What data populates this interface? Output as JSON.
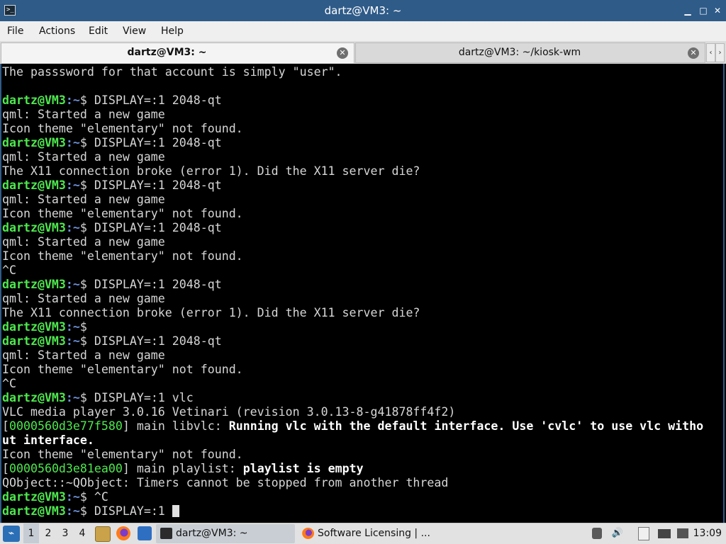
{
  "window": {
    "title": "dartz@VM3: ~",
    "app_icon": ">_",
    "buttons": {
      "minimize": "▁",
      "maximize": "□",
      "close": "✕"
    }
  },
  "menu": {
    "items": [
      "File",
      "Actions",
      "Edit",
      "View",
      "Help"
    ]
  },
  "tabs": [
    {
      "label": "dartz@VM3: ~",
      "active": true
    },
    {
      "label": "dartz@VM3: ~/kiosk-wm",
      "active": false
    }
  ],
  "tab_scroll": {
    "left": "‹",
    "right": "›"
  },
  "terminal": {
    "prompt_user": "dartz@VM3",
    "prompt_path": ":~",
    "prompt_symbol": "$ ",
    "lines": [
      {
        "type": "out",
        "text": "The passsword for that account is simply \"user\"."
      },
      {
        "type": "out",
        "text": ""
      },
      {
        "type": "cmd",
        "text": "DISPLAY=:1 2048-qt"
      },
      {
        "type": "out",
        "text": "qml: Started a new game"
      },
      {
        "type": "out",
        "text": "Icon theme \"elementary\" not found."
      },
      {
        "type": "cmd",
        "text": "DISPLAY=:1 2048-qt"
      },
      {
        "type": "out",
        "text": "qml: Started a new game"
      },
      {
        "type": "out",
        "text": "The X11 connection broke (error 1). Did the X11 server die?"
      },
      {
        "type": "cmd",
        "text": "DISPLAY=:1 2048-qt"
      },
      {
        "type": "out",
        "text": "qml: Started a new game"
      },
      {
        "type": "out",
        "text": "Icon theme \"elementary\" not found."
      },
      {
        "type": "cmd",
        "text": "DISPLAY=:1 2048-qt"
      },
      {
        "type": "out",
        "text": "qml: Started a new game"
      },
      {
        "type": "out",
        "text": "Icon theme \"elementary\" not found."
      },
      {
        "type": "out",
        "text": "^C"
      },
      {
        "type": "cmd",
        "text": "DISPLAY=:1 2048-qt"
      },
      {
        "type": "out",
        "text": "qml: Started a new game"
      },
      {
        "type": "out",
        "text": "The X11 connection broke (error 1). Did the X11 server die?"
      },
      {
        "type": "cmd",
        "text": ""
      },
      {
        "type": "cmd",
        "text": "DISPLAY=:1 2048-qt"
      },
      {
        "type": "out",
        "text": "qml: Started a new game"
      },
      {
        "type": "out",
        "text": "Icon theme \"elementary\" not found."
      },
      {
        "type": "out",
        "text": "^C"
      },
      {
        "type": "cmd",
        "text": "DISPLAY=:1 vlc"
      },
      {
        "type": "out",
        "text": "VLC media player 3.0.16 Vetinari (revision 3.0.13-8-g41878ff4f2)"
      },
      {
        "type": "log",
        "hex": "0000560d3e77f580",
        "module": " main libvlc: ",
        "msg": "Running vlc with the default interface. Use 'cvlc' to use vlc witho"
      },
      {
        "type": "bold",
        "text": "ut interface."
      },
      {
        "type": "out",
        "text": "Icon theme \"elementary\" not found."
      },
      {
        "type": "log",
        "hex": "0000560d3e81ea00",
        "module": " main playlist: ",
        "msg": "playlist is empty"
      },
      {
        "type": "out",
        "text": "QObject::~QObject: Timers cannot be stopped from another thread"
      },
      {
        "type": "cmd",
        "text": "^C"
      },
      {
        "type": "cmd",
        "text": "DISPLAY=:1 ",
        "cursor": true
      }
    ]
  },
  "taskbar": {
    "start_icon": "⌁",
    "workspaces": [
      "1",
      "2",
      "3",
      "4"
    ],
    "active_workspace": "1",
    "tasks": [
      {
        "label": "dartz@VM3: ~",
        "icon": "terminal-icon"
      },
      {
        "label": "Software Licensing | ...",
        "icon": "firefox-icon"
      }
    ],
    "tray": {
      "volume": "🔊",
      "clock": "13:09"
    }
  },
  "colors": {
    "titlebar": "#2f5b88",
    "prompt_user": "#4ee84e",
    "prompt_path": "#6b8fd6",
    "terminal_bg": "#000000",
    "terminal_fg": "#d6d6d6"
  }
}
